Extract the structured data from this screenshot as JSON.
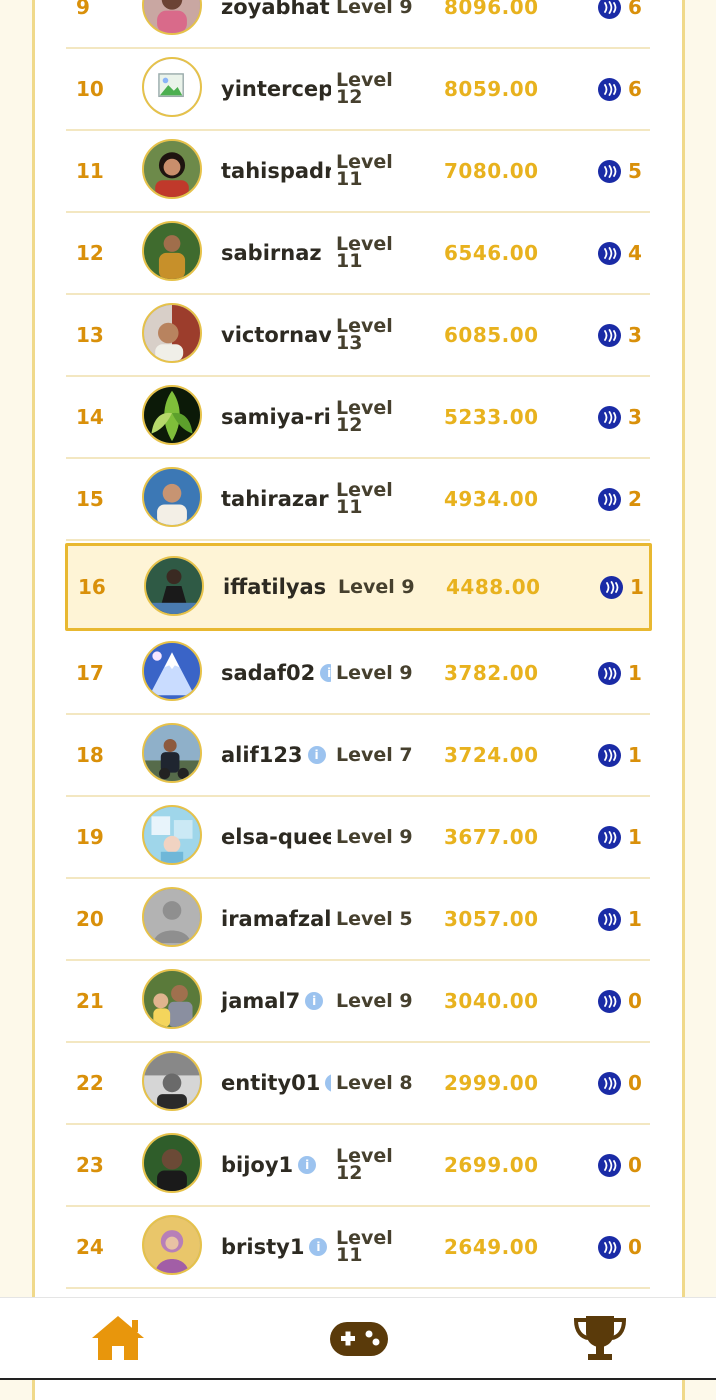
{
  "leaderboard": {
    "rows": [
      {
        "rank": "9",
        "name": "zoyabhat",
        "level": "Level 9",
        "score": "8096.00",
        "reward": "6",
        "info": false,
        "avatar": "photo-a"
      },
      {
        "rank": "10",
        "name": "yintercep",
        "level": "Level 12",
        "score": "8059.00",
        "reward": "6",
        "info": false,
        "avatar": "broken-image"
      },
      {
        "rank": "11",
        "name": "tahispadr",
        "level": "Level 11",
        "score": "7080.00",
        "reward": "5",
        "info": false,
        "avatar": "photo-b"
      },
      {
        "rank": "12",
        "name": "sabirnaz",
        "level": "Level 11",
        "score": "6546.00",
        "reward": "4",
        "info": false,
        "avatar": "photo-c"
      },
      {
        "rank": "13",
        "name": "victornav",
        "level": "Level 13",
        "score": "6085.00",
        "reward": "3",
        "info": false,
        "avatar": "photo-d"
      },
      {
        "rank": "14",
        "name": "samiya-ri",
        "level": "Level 12",
        "score": "5233.00",
        "reward": "3",
        "info": false,
        "avatar": "leaves"
      },
      {
        "rank": "15",
        "name": "tahirazar",
        "level": "Level 11",
        "score": "4934.00",
        "reward": "2",
        "info": false,
        "avatar": "photo-e"
      },
      {
        "rank": "16",
        "name": "iffatilyas",
        "level": "Level 9",
        "score": "4488.00",
        "reward": "1",
        "info": false,
        "avatar": "photo-f",
        "highlight": true
      },
      {
        "rank": "17",
        "name": "sadaf02",
        "level": "Level 9",
        "score": "3782.00",
        "reward": "1",
        "info": true,
        "avatar": "mountain"
      },
      {
        "rank": "18",
        "name": "alif123",
        "level": "Level 7",
        "score": "3724.00",
        "reward": "1",
        "info": true,
        "avatar": "photo-g"
      },
      {
        "rank": "19",
        "name": "elsa-queen",
        "level": "Level 9",
        "score": "3677.00",
        "reward": "1",
        "info": false,
        "avatar": "photo-h"
      },
      {
        "rank": "20",
        "name": "iramafzal",
        "level": "Level 5",
        "score": "3057.00",
        "reward": "1",
        "info": false,
        "avatar": "default-user"
      },
      {
        "rank": "21",
        "name": "jamal7",
        "level": "Level 9",
        "score": "3040.00",
        "reward": "0",
        "info": true,
        "avatar": "photo-i"
      },
      {
        "rank": "22",
        "name": "entity01",
        "level": "Level 8",
        "score": "2999.00",
        "reward": "0",
        "info": true,
        "avatar": "photo-j"
      },
      {
        "rank": "23",
        "name": "bijoy1",
        "level": "Level 12",
        "score": "2699.00",
        "reward": "0",
        "info": true,
        "avatar": "photo-k"
      },
      {
        "rank": "24",
        "name": "bristy1",
        "level": "Level 11",
        "score": "2649.00",
        "reward": "0",
        "info": true,
        "avatar": "photo-l"
      }
    ]
  },
  "bottom_nav": {
    "items": [
      {
        "name": "home",
        "icon": "home-icon",
        "active": true
      },
      {
        "name": "games",
        "icon": "gamepad-icon",
        "active": false
      },
      {
        "name": "leaderboard",
        "icon": "trophy-icon",
        "active": false
      }
    ]
  },
  "colors": {
    "accent": "#d9900a",
    "score": "#e8b21e",
    "highlight_border": "#e8b830",
    "steem_blue": "#1a2ba6",
    "nav_dark": "#5a3a0a"
  }
}
